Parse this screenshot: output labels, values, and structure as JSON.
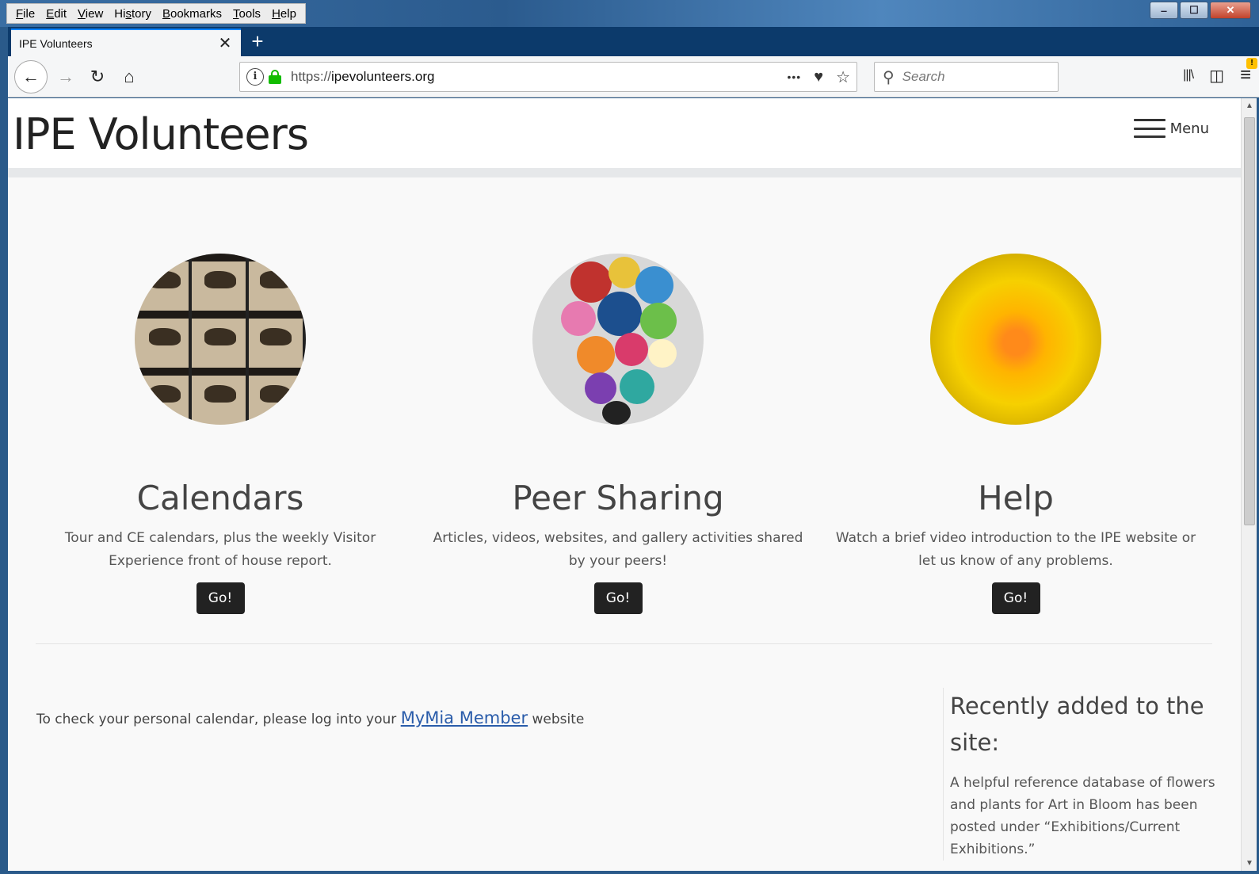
{
  "menubar": {
    "items": [
      "File",
      "Edit",
      "View",
      "History",
      "Bookmarks",
      "Tools",
      "Help"
    ],
    "underline": [
      "F",
      "E",
      "V",
      "s",
      "B",
      "T",
      "H"
    ]
  },
  "window_controls": {
    "minimize": "‒",
    "maximize": "☐",
    "close": "✕"
  },
  "tab": {
    "title": "IPE Volunteers",
    "close_glyph": "✕",
    "new_tab_glyph": "+"
  },
  "navbar": {
    "back_glyph": "←",
    "forward_glyph": "→",
    "reload_glyph": "↻",
    "home_glyph": "⌂",
    "url_protocol": "https://",
    "url_host": "ipevolunteers.org",
    "info_glyph": "i",
    "page_actions_glyph": "•••",
    "pocket_glyph": "♥",
    "bookmark_glyph": "☆",
    "search_placeholder": "Search",
    "search_glyph": "⚲",
    "library_glyph": "|||\\",
    "sidebar_glyph": "◫",
    "menu_glyph": "≡",
    "menu_badge": "!"
  },
  "site": {
    "title": "IPE Volunteers",
    "menu_label": "Menu"
  },
  "cards": [
    {
      "title": "Calendars",
      "description": "Tour and CE calendars, plus the weekly Visitor Experience front of house report.",
      "button": "Go!"
    },
    {
      "title": "Peer Sharing",
      "description": "Articles, videos, websites, and gallery activities shared by your peers!",
      "button": "Go!"
    },
    {
      "title": "Help",
      "description": "Watch a brief video introduction to the IPE website or let us know of any problems.",
      "button": "Go!"
    }
  ],
  "calendar_note": {
    "prefix": "To check your personal calendar, please log into your",
    "link": "MyMia Member",
    "suffix": "website"
  },
  "recent": {
    "title": "Recently added to the site:",
    "text": "A helpful reference database of flowers and plants for Art in Bloom has been posted under “Exhibitions/Current Exhibitions.”"
  },
  "scrollbar": {
    "up_glyph": "▲",
    "down_glyph": "▼"
  }
}
